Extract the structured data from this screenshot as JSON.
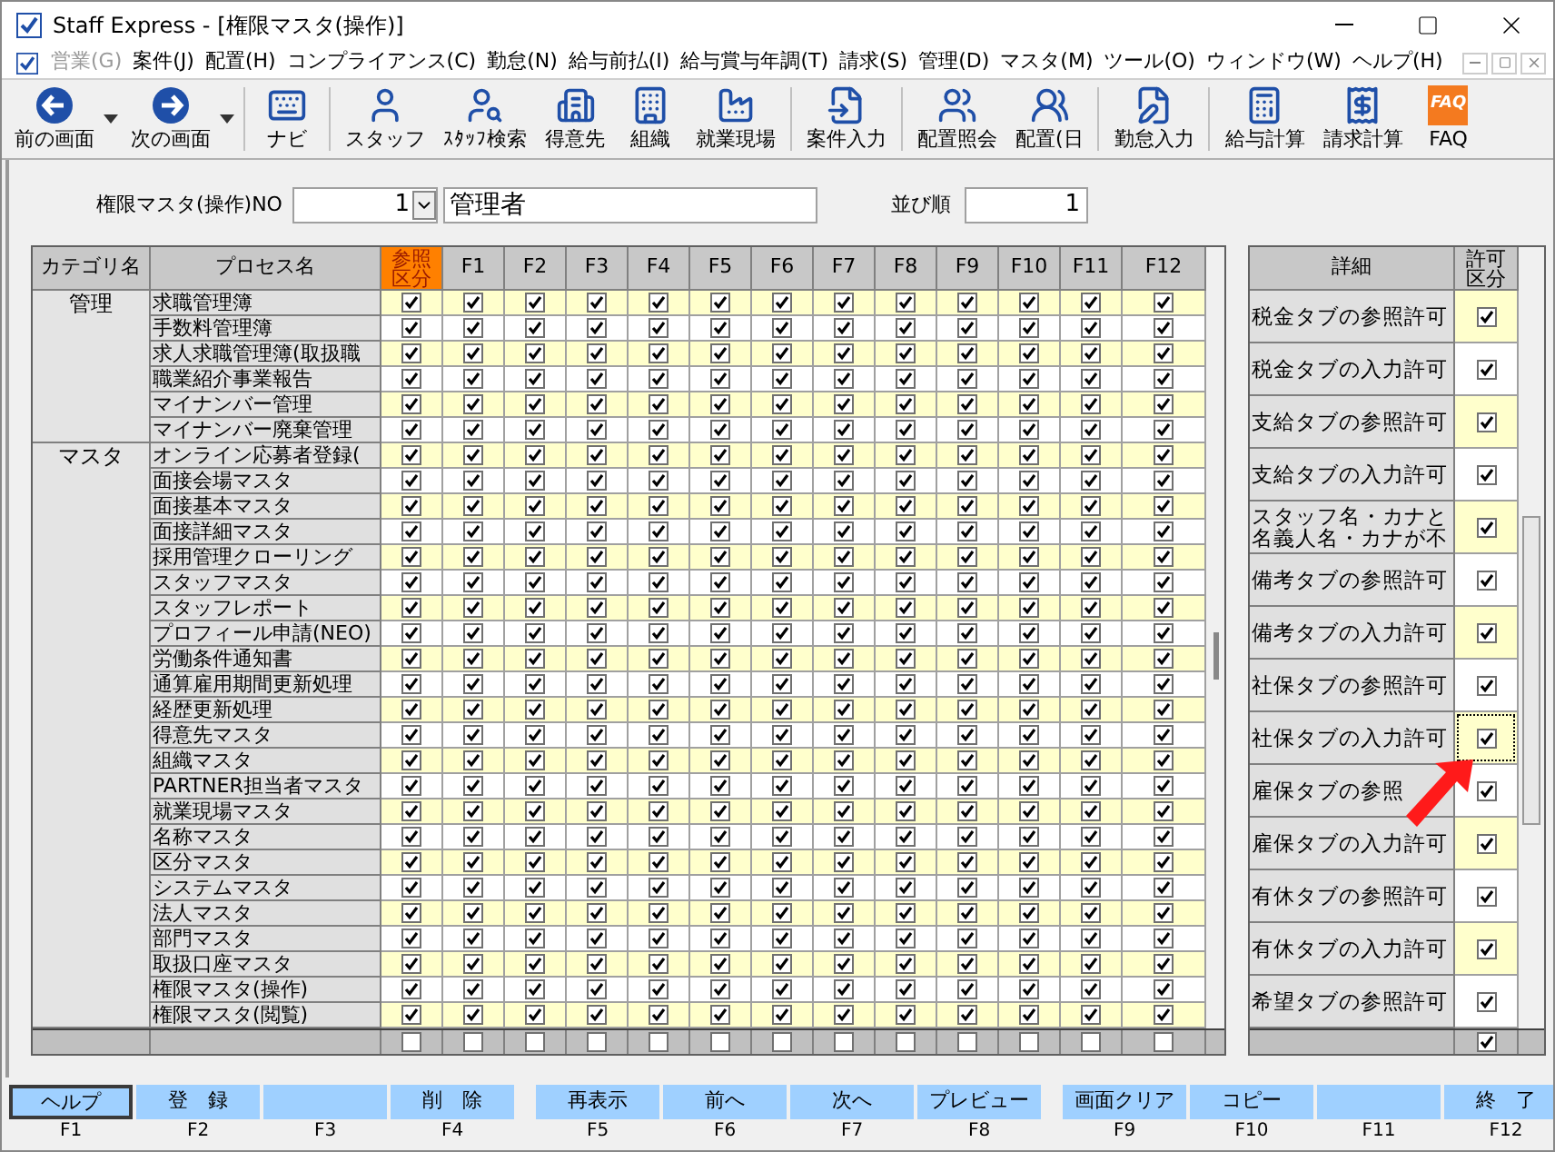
{
  "window": {
    "title": "Staff Express - [権限マスタ(操作)]"
  },
  "menu": [
    {
      "label": "営業(G)",
      "disabled": true
    },
    {
      "label": "案件(J)",
      "disabled": false
    },
    {
      "label": "配置(H)",
      "disabled": false
    },
    {
      "label": "コンプライアンス(C)",
      "disabled": false
    },
    {
      "label": "勤怠(N)",
      "disabled": false
    },
    {
      "label": "給与前払(I)",
      "disabled": false
    },
    {
      "label": "給与賞与年調(T)",
      "disabled": false
    },
    {
      "label": "請求(S)",
      "disabled": false
    },
    {
      "label": "管理(D)",
      "disabled": false
    },
    {
      "label": "マスタ(M)",
      "disabled": false
    },
    {
      "label": "ツール(O)",
      "disabled": false
    },
    {
      "label": "ウィンドウ(W)",
      "disabled": false
    },
    {
      "label": "ヘルプ(H)",
      "disabled": false
    }
  ],
  "toolbar": [
    {
      "label": "前の画面",
      "dropdown": true,
      "separator_before": false
    },
    {
      "label": "次の画面",
      "dropdown": true,
      "separator_before": false
    },
    {
      "label": "ナビ",
      "dropdown": false,
      "separator_before": true
    },
    {
      "label": "スタッフ",
      "dropdown": false,
      "separator_before": true
    },
    {
      "label": "ｽﾀｯﾌ検索",
      "dropdown": false,
      "separator_before": false
    },
    {
      "label": "得意先",
      "dropdown": false,
      "separator_before": false
    },
    {
      "label": "組織",
      "dropdown": false,
      "separator_before": false
    },
    {
      "label": "就業現場",
      "dropdown": false,
      "separator_before": false
    },
    {
      "label": "案件入力",
      "dropdown": false,
      "separator_before": true
    },
    {
      "label": "配置照会",
      "dropdown": false,
      "separator_before": true
    },
    {
      "label": "配置(日",
      "dropdown": false,
      "separator_before": false
    },
    {
      "label": "勤怠入力",
      "dropdown": false,
      "separator_before": true
    },
    {
      "label": "給与計算",
      "dropdown": false,
      "separator_before": true
    },
    {
      "label": "請求計算",
      "dropdown": false,
      "separator_before": false
    },
    {
      "label": "FAQ",
      "icon_text": "FAQ",
      "dropdown": false,
      "separator_before": false
    }
  ],
  "form": {
    "no_label": "権限マスタ(操作)NO",
    "no_value": "1",
    "name_value": "管理者",
    "order_label": "並び順",
    "order_value": "1"
  },
  "grid": {
    "columns": [
      "カテゴリ名",
      "プロセス名",
      "参照区分",
      "F1",
      "F2",
      "F3",
      "F4",
      "F5",
      "F6",
      "F7",
      "F8",
      "F9",
      "F10",
      "F11",
      "F12"
    ],
    "groups": [
      {
        "category": "管理",
        "rows": [
          {
            "process": "求職管理簿",
            "checks": [
              true,
              true,
              true,
              true,
              true,
              true,
              true,
              true,
              true,
              true,
              true,
              true,
              true
            ]
          },
          {
            "process": "手数料管理簿",
            "checks": [
              true,
              true,
              true,
              true,
              true,
              true,
              true,
              true,
              true,
              true,
              true,
              true,
              true
            ]
          },
          {
            "process": "求人求職管理簿(取扱職",
            "checks": [
              true,
              true,
              true,
              true,
              true,
              true,
              true,
              true,
              true,
              true,
              true,
              true,
              true
            ]
          },
          {
            "process": "職業紹介事業報告",
            "checks": [
              true,
              true,
              true,
              true,
              true,
              true,
              true,
              true,
              true,
              true,
              true,
              true,
              true
            ]
          },
          {
            "process": "マイナンバー管理",
            "checks": [
              true,
              true,
              true,
              true,
              true,
              true,
              true,
              true,
              true,
              true,
              true,
              true,
              true
            ]
          },
          {
            "process": "マイナンバー廃棄管理",
            "checks": [
              true,
              true,
              true,
              true,
              true,
              true,
              true,
              true,
              true,
              true,
              true,
              true,
              true
            ]
          }
        ]
      },
      {
        "category": "マスタ",
        "rows": [
          {
            "process": "オンライン応募者登録(",
            "checks": [
              true,
              true,
              true,
              true,
              true,
              true,
              true,
              true,
              true,
              true,
              true,
              true,
              true
            ]
          },
          {
            "process": "面接会場マスタ",
            "checks": [
              true,
              true,
              true,
              true,
              true,
              true,
              true,
              true,
              true,
              true,
              true,
              true,
              true
            ]
          },
          {
            "process": "面接基本マスタ",
            "checks": [
              true,
              true,
              true,
              true,
              true,
              true,
              true,
              true,
              true,
              true,
              true,
              true,
              true
            ]
          },
          {
            "process": "面接詳細マスタ",
            "checks": [
              true,
              true,
              true,
              true,
              true,
              true,
              true,
              true,
              true,
              true,
              true,
              true,
              true
            ]
          },
          {
            "process": "採用管理クローリング",
            "checks": [
              true,
              true,
              true,
              true,
              true,
              true,
              true,
              true,
              true,
              true,
              true,
              true,
              true
            ]
          },
          {
            "process": "スタッフマスタ",
            "checks": [
              true,
              true,
              true,
              true,
              true,
              true,
              true,
              true,
              true,
              true,
              true,
              true,
              true
            ]
          },
          {
            "process": "スタッフレポート",
            "checks": [
              true,
              true,
              true,
              true,
              true,
              true,
              true,
              true,
              true,
              true,
              true,
              true,
              true
            ]
          },
          {
            "process": "プロフィール申請(NEO)",
            "checks": [
              true,
              true,
              true,
              true,
              true,
              true,
              true,
              true,
              true,
              true,
              true,
              true,
              true
            ]
          },
          {
            "process": "労働条件通知書",
            "checks": [
              true,
              true,
              true,
              true,
              true,
              true,
              true,
              true,
              true,
              true,
              true,
              true,
              true
            ]
          },
          {
            "process": "通算雇用期間更新処理",
            "checks": [
              true,
              true,
              true,
              true,
              true,
              true,
              true,
              true,
              true,
              true,
              true,
              true,
              true
            ]
          },
          {
            "process": "経歴更新処理",
            "checks": [
              true,
              true,
              true,
              true,
              true,
              true,
              true,
              true,
              true,
              true,
              true,
              true,
              true
            ]
          },
          {
            "process": "得意先マスタ",
            "checks": [
              true,
              true,
              true,
              true,
              true,
              true,
              true,
              true,
              true,
              true,
              true,
              true,
              true
            ]
          },
          {
            "process": "組織マスタ",
            "checks": [
              true,
              true,
              true,
              true,
              true,
              true,
              true,
              true,
              true,
              true,
              true,
              true,
              true
            ]
          },
          {
            "process": "PARTNER担当者マスタ",
            "checks": [
              true,
              true,
              true,
              true,
              true,
              true,
              true,
              true,
              true,
              true,
              true,
              true,
              true
            ]
          },
          {
            "process": "就業現場マスタ",
            "checks": [
              true,
              true,
              true,
              true,
              true,
              true,
              true,
              true,
              true,
              true,
              true,
              true,
              true
            ]
          },
          {
            "process": "名称マスタ",
            "checks": [
              true,
              true,
              true,
              true,
              true,
              true,
              true,
              true,
              true,
              true,
              true,
              true,
              true
            ]
          },
          {
            "process": "区分マスタ",
            "checks": [
              true,
              true,
              true,
              true,
              true,
              true,
              true,
              true,
              true,
              true,
              true,
              true,
              true
            ]
          },
          {
            "process": "システムマスタ",
            "checks": [
              true,
              true,
              true,
              true,
              true,
              true,
              true,
              true,
              true,
              true,
              true,
              true,
              true
            ]
          },
          {
            "process": "法人マスタ",
            "checks": [
              true,
              true,
              true,
              true,
              true,
              true,
              true,
              true,
              true,
              true,
              true,
              true,
              true
            ]
          },
          {
            "process": "部門マスタ",
            "checks": [
              true,
              true,
              true,
              true,
              true,
              true,
              true,
              true,
              true,
              true,
              true,
              true,
              true
            ]
          },
          {
            "process": "取扱口座マスタ",
            "checks": [
              true,
              true,
              true,
              true,
              true,
              true,
              true,
              true,
              true,
              true,
              true,
              true,
              true
            ]
          },
          {
            "process": "権限マスタ(操作)",
            "checks": [
              true,
              true,
              true,
              true,
              true,
              true,
              true,
              true,
              true,
              true,
              true,
              true,
              true
            ]
          },
          {
            "process": "権限マスタ(閲覧)",
            "checks": [
              true,
              true,
              true,
              true,
              true,
              true,
              true,
              true,
              true,
              true,
              true,
              true,
              true
            ]
          }
        ]
      }
    ],
    "footer_checks": [
      false,
      false,
      false,
      false,
      false,
      false,
      false,
      false,
      false,
      false,
      false,
      false,
      false
    ]
  },
  "details": {
    "columns": [
      "詳細",
      "許可区分"
    ],
    "rows": [
      {
        "label": "税金タブの参照許可",
        "checked": true,
        "focused": false
      },
      {
        "label": "税金タブの入力許可",
        "checked": true,
        "focused": false
      },
      {
        "label": "支給タブの参照許可",
        "checked": true,
        "focused": false
      },
      {
        "label": "支給タブの入力許可",
        "checked": true,
        "focused": false
      },
      {
        "label": "スタッフ名・カナと名義人名・カナが不",
        "checked": true,
        "focused": false
      },
      {
        "label": "備考タブの参照許可",
        "checked": true,
        "focused": false
      },
      {
        "label": "備考タブの入力許可",
        "checked": true,
        "focused": false
      },
      {
        "label": "社保タブの参照許可",
        "checked": true,
        "focused": false
      },
      {
        "label": "社保タブの入力許可",
        "checked": true,
        "focused": true
      },
      {
        "label": "雇保タブの参照",
        "checked": true,
        "focused": false
      },
      {
        "label": "雇保タブの入力許可",
        "checked": true,
        "focused": false
      },
      {
        "label": "有休タブの参照許可",
        "checked": true,
        "focused": false
      },
      {
        "label": "有休タブの入力許可",
        "checked": true,
        "focused": false
      },
      {
        "label": "希望タブの参照許可",
        "checked": true,
        "focused": false
      }
    ],
    "footer_checked": true
  },
  "function_keys": [
    {
      "label": "ヘルプ",
      "key": "F1",
      "selected": true
    },
    {
      "label": "登　録",
      "key": "F2",
      "selected": false
    },
    {
      "key": "F3",
      "selected": false
    },
    {
      "label": "削　除",
      "key": "F4",
      "selected": false
    },
    {
      "label": "再表示",
      "key": "F5",
      "selected": false
    },
    {
      "label": "前へ",
      "key": "F6",
      "selected": false
    },
    {
      "label": "次へ",
      "key": "F7",
      "selected": false
    },
    {
      "label": "プレビュー",
      "key": "F8",
      "selected": false
    },
    {
      "label": "画面クリア",
      "key": "F9",
      "selected": false
    },
    {
      "label": "コピー",
      "key": "F10",
      "selected": false
    },
    {
      "key": "F11",
      "selected": false
    },
    {
      "label": "終　了",
      "key": "F12",
      "selected": false
    }
  ]
}
